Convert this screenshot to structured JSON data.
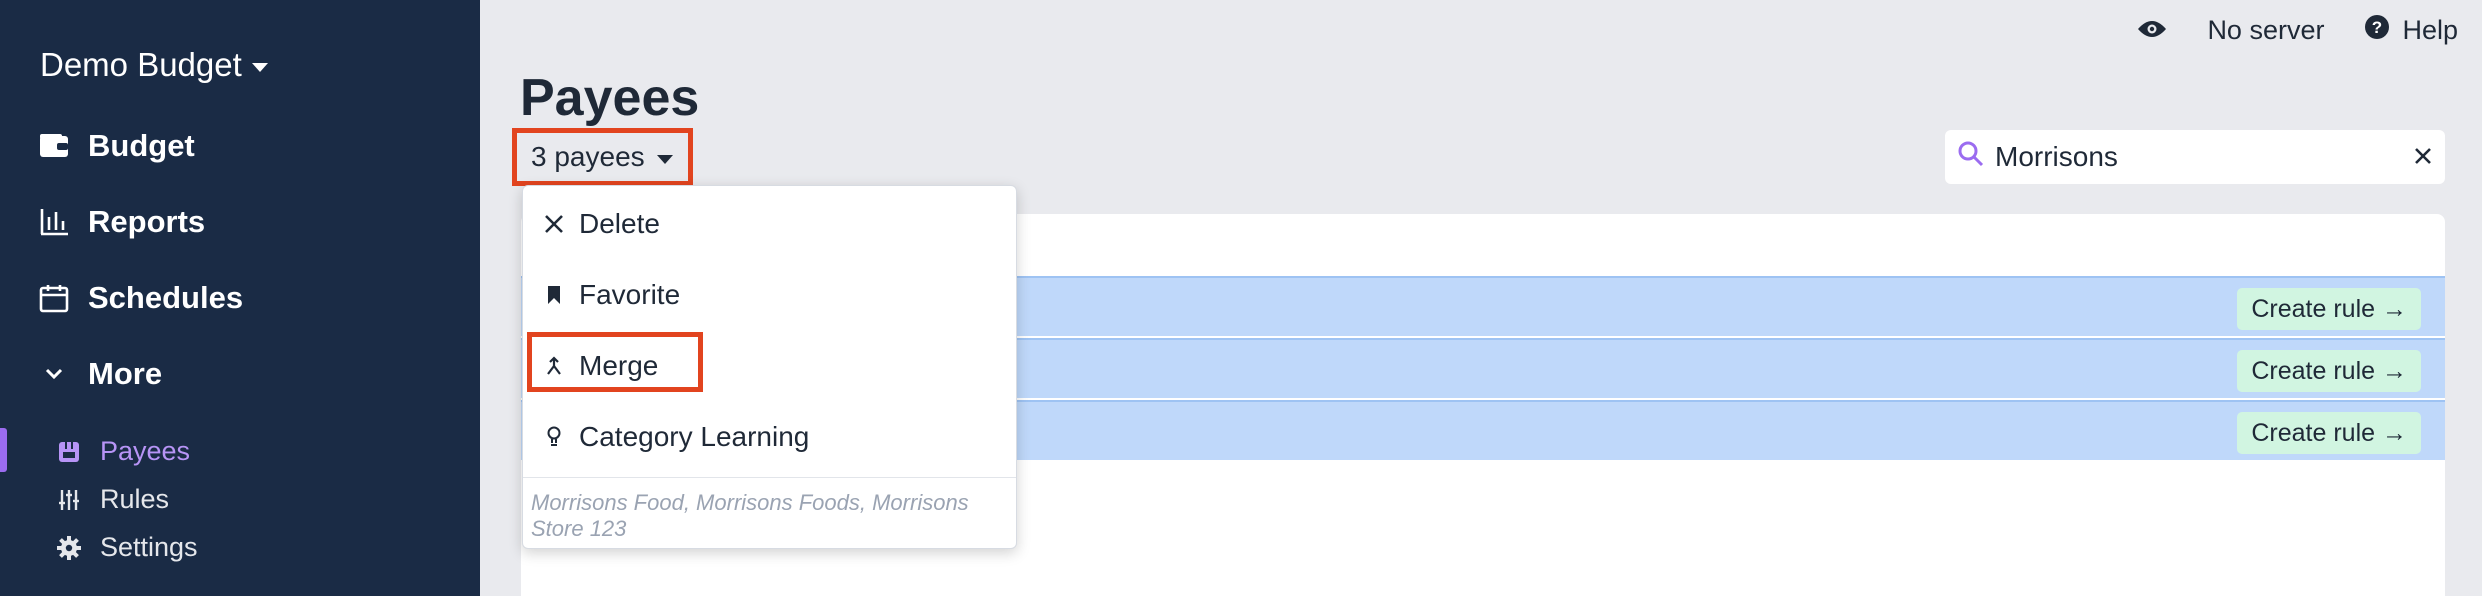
{
  "sidebar": {
    "budget_name": "Demo Budget",
    "nav": [
      {
        "label": "Budget",
        "icon": "wallet-icon"
      },
      {
        "label": "Reports",
        "icon": "chart-icon"
      },
      {
        "label": "Schedules",
        "icon": "calendar-icon"
      },
      {
        "label": "More",
        "icon": "chevron-down-icon"
      }
    ],
    "sub": [
      {
        "label": "Payees",
        "icon": "store-icon",
        "active": true
      },
      {
        "label": "Rules",
        "icon": "sliders-icon"
      },
      {
        "label": "Settings",
        "icon": "gear-icon"
      }
    ]
  },
  "topbar": {
    "server_label": "No server",
    "help_label": "Help"
  },
  "page": {
    "title": "Payees",
    "selected_count_label": "3 payees"
  },
  "search": {
    "value": "Morrisons"
  },
  "rows": [
    {
      "action_label": "Create rule →"
    },
    {
      "action_label": "Create rule →"
    },
    {
      "action_label": "Create rule →"
    }
  ],
  "menu": {
    "items": [
      {
        "label": "Delete",
        "icon": "close-icon"
      },
      {
        "label": "Favorite",
        "icon": "bookmark-icon"
      },
      {
        "label": "Merge",
        "icon": "merge-icon"
      },
      {
        "label": "Category Learning",
        "icon": "lightbulb-icon"
      }
    ],
    "note": "Morrisons Food, Morrisons Foods, Morrisons Store 123"
  },
  "colors": {
    "sidebar_bg": "#1a2b45",
    "accent": "#9b6cf0",
    "highlight": "#e2441f",
    "selected_row": "#bfd8fa",
    "rule_button": "#d1f5e1"
  }
}
